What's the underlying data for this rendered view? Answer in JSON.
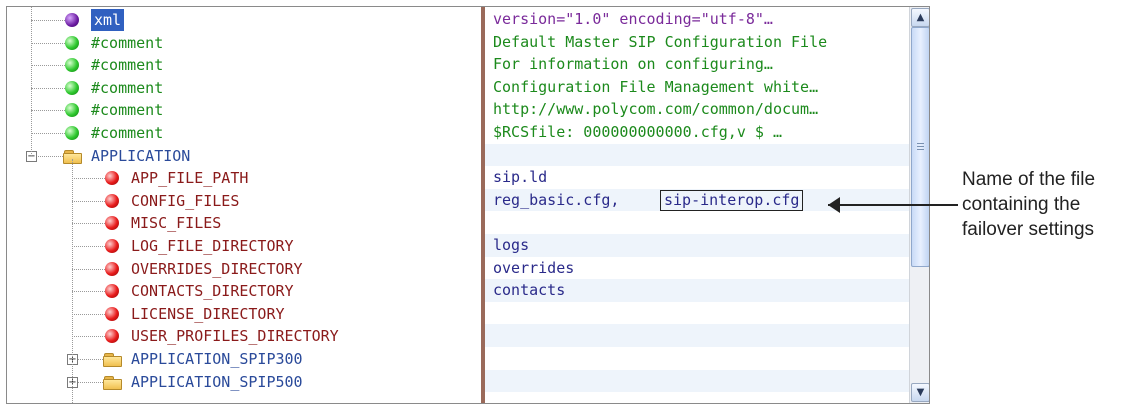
{
  "tree": {
    "nodes": [
      {
        "label": "xml",
        "icon": "purple-ball-icon",
        "kind": "decl",
        "selected": true
      },
      {
        "label": "#comment",
        "icon": "green-ball-icon",
        "kind": "comment"
      },
      {
        "label": "#comment",
        "icon": "green-ball-icon",
        "kind": "comment"
      },
      {
        "label": "#comment",
        "icon": "green-ball-icon",
        "kind": "comment"
      },
      {
        "label": "#comment",
        "icon": "green-ball-icon",
        "kind": "comment"
      },
      {
        "label": "#comment",
        "icon": "green-ball-icon",
        "kind": "comment"
      },
      {
        "label": "APPLICATION",
        "icon": "folder-icon",
        "kind": "element",
        "expander": "−"
      },
      {
        "label": "APP_FILE_PATH",
        "icon": "red-ball-icon",
        "kind": "attribute"
      },
      {
        "label": "CONFIG_FILES",
        "icon": "red-ball-icon",
        "kind": "attribute"
      },
      {
        "label": "MISC_FILES",
        "icon": "red-ball-icon",
        "kind": "attribute"
      },
      {
        "label": "LOG_FILE_DIRECTORY",
        "icon": "red-ball-icon",
        "kind": "attribute"
      },
      {
        "label": "OVERRIDES_DIRECTORY",
        "icon": "red-ball-icon",
        "kind": "attribute"
      },
      {
        "label": "CONTACTS_DIRECTORY",
        "icon": "red-ball-icon",
        "kind": "attribute"
      },
      {
        "label": "LICENSE_DIRECTORY",
        "icon": "red-ball-icon",
        "kind": "attribute"
      },
      {
        "label": "USER_PROFILES_DIRECTORY",
        "icon": "red-ball-icon",
        "kind": "attribute"
      },
      {
        "label": "APPLICATION_SPIP300",
        "icon": "folder-icon",
        "kind": "element",
        "expander": "+"
      },
      {
        "label": "APPLICATION_SPIP500",
        "icon": "folder-icon",
        "kind": "element",
        "expander": "+"
      }
    ]
  },
  "values": [
    "version=\"1.0\" encoding=\"utf-8\"…",
    "Default Master SIP Configuration File",
    "For information on configuring…",
    "Configuration File Management white…",
    "http://www.polycom.com/common/docum…",
    "$RCSfile: 000000000000.cfg,v $ …",
    "",
    "sip.ld",
    "reg_basic.cfg, ",
    "",
    "logs",
    "overrides",
    "contacts",
    "",
    "",
    "",
    ""
  ],
  "highlighted_value": "sip-interop.cfg",
  "scrollbar": {
    "up": "▲",
    "down": "▼"
  },
  "annotation": {
    "line1": "Name of the file",
    "line2": "containing the",
    "line3": "failover settings"
  }
}
